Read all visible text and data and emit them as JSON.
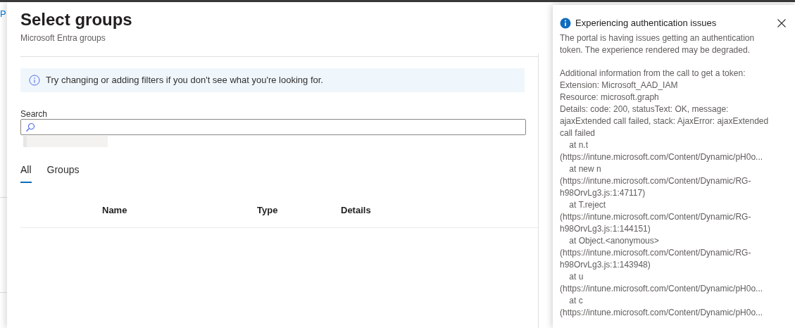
{
  "background": {
    "link_fragment": "P"
  },
  "panel": {
    "title": "Select groups",
    "subtitle": "Microsoft Entra groups",
    "info_message": "Try changing or adding filters if you don't see what you're looking for.",
    "search": {
      "label": "Search"
    },
    "tabs": [
      {
        "label": "All",
        "selected": true
      },
      {
        "label": "Groups",
        "selected": false
      }
    ],
    "table": {
      "columns": [
        "Name",
        "Type",
        "Details"
      ]
    }
  },
  "notification": {
    "title": "Experiencing authentication issues",
    "paragraphs": [
      "The portal is having issues getting an authentication\ntoken. The experience rendered may be degraded.",
      "Additional information from the call to get a token:\nExtension: Microsoft_AAD_IAM\nResource: microsoft.graph\nDetails: code: 200, statusText: OK, message:\najaxExtended call failed, stack: AjaxError: ajaxExtended\ncall failed\n    at n.t\n(https://intune.microsoft.com/Content/Dynamic/pH0o...\n    at new n\n(https://intune.microsoft.com/Content/Dynamic/RG-\nh98OrvLg3.js:1:47117)\n    at T.reject\n(https://intune.microsoft.com/Content/Dynamic/RG-\nh98OrvLg3.js:1:144151)\n    at Object.<anonymous>\n(https://intune.microsoft.com/Content/Dynamic/RG-\nh98OrvLg3.js:1:143948)\n    at u\n(https://intune.microsoft.com/Content/Dynamic/pH0o...\n    at c\n(https://intune.microsoft.com/Content/Dynamic/pH0o..."
    ]
  }
}
